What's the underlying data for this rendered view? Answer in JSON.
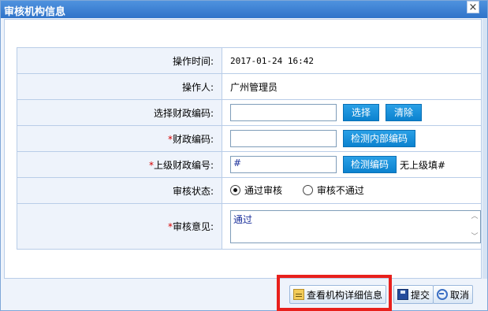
{
  "window": {
    "title": "审核机构信息",
    "close_glyph": "×"
  },
  "form": {
    "rows": [
      {
        "label": "操作时间:",
        "value": "2017-01-24 16:42"
      },
      {
        "label": "操作人:",
        "value": "广州管理员"
      },
      {
        "label": "选择财政编码:",
        "input_value": "",
        "btn_select": "选择",
        "btn_clear": "清除"
      },
      {
        "label": "财政编码:",
        "required": "*",
        "input_value": "",
        "btn_check_inner": "检测内部编码"
      },
      {
        "label": "上级财政编号:",
        "required": "*",
        "input_value": "#",
        "btn_check": "检测编码",
        "note": "无上级填#"
      },
      {
        "label": "审核状态:",
        "radio_pass": "通过审核",
        "radio_fail": "审核不通过",
        "selected": "通过审核"
      },
      {
        "label": "审核意见:",
        "required": "*",
        "textarea_value": "通过"
      }
    ]
  },
  "footer": {
    "detail_btn": "查看机构详细信息",
    "submit_btn": "提交",
    "cancel_btn": "取消"
  },
  "icons": {
    "detail": "edit-document-icon",
    "submit": "save-disk-icon",
    "cancel": "undo-arrow-icon"
  },
  "colors": {
    "title_bar": "#3d83d6",
    "button_blue": "#1890da",
    "highlight_border": "#e8201c",
    "required_mark": "#d40000"
  }
}
